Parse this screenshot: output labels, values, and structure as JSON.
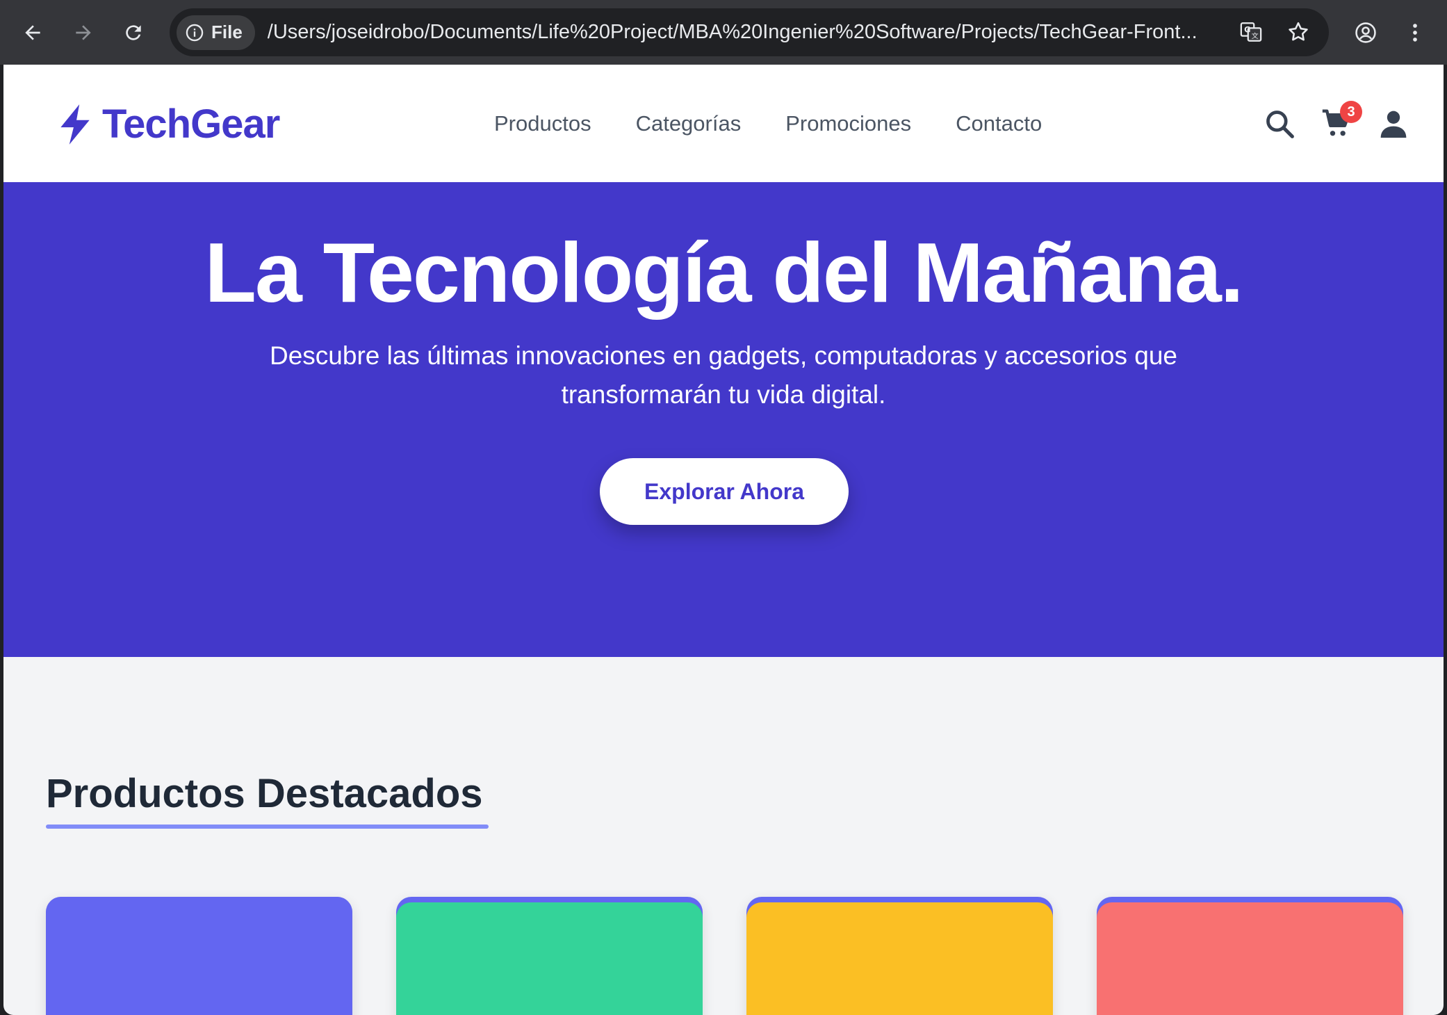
{
  "browser": {
    "file_chip_label": "File",
    "url": "/Users/joseidrobo/Documents/Life%20Project/MBA%20Ingenier%20Software/Projects/TechGear-Front..."
  },
  "header": {
    "logo_text": "TechGear",
    "nav": [
      "Productos",
      "Categorías",
      "Promociones",
      "Contacto"
    ],
    "cart_count": "3"
  },
  "hero": {
    "title": "La Tecnología del Mañana.",
    "subtitle": "Descubre las últimas innovaciones en gadgets, computadoras y accesorios que transformarán tu vida digital.",
    "cta_label": "Explorar Ahora"
  },
  "featured": {
    "title": "Productos Destacados",
    "cards": [
      {
        "color": "#6366f1"
      },
      {
        "color": "#34d399"
      },
      {
        "color": "#fbbf24"
      },
      {
        "color": "#f87171"
      }
    ]
  },
  "colors": {
    "brand": "#4338ca",
    "accent_underline": "#818cf8",
    "badge": "#ef4444"
  }
}
